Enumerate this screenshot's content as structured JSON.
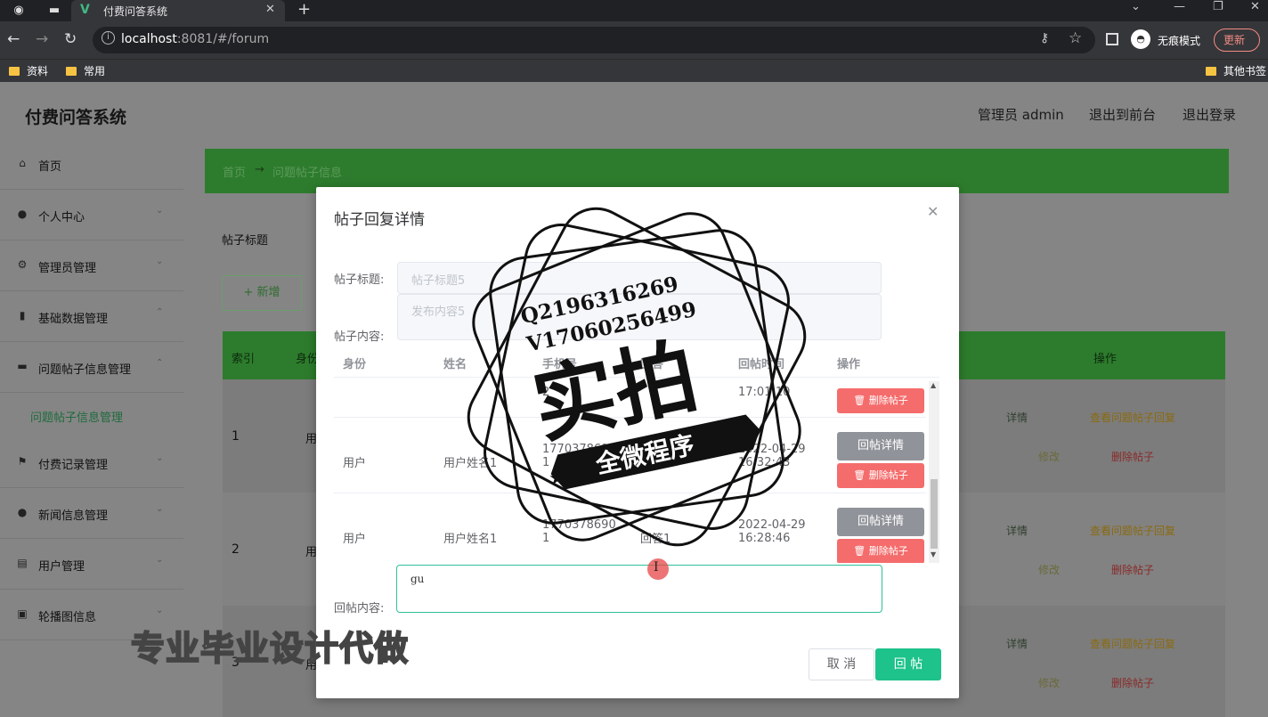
{
  "browser": {
    "tab_title": "付费问答系统",
    "url_host": "localhost",
    "url_rest": ":8081/#/forum",
    "incognito_label": "无痕模式",
    "update_label": "更新",
    "bookmarks": [
      "资料",
      "常用",
      "其他书签"
    ]
  },
  "app": {
    "title": "付费问答系统",
    "header_links": [
      "管理员 admin",
      "退出到前台",
      "退出登录"
    ]
  },
  "sidebar": {
    "items": [
      {
        "label": "首页",
        "icon": "home-icon"
      },
      {
        "label": "个人中心",
        "icon": "user-icon"
      },
      {
        "label": "管理员管理",
        "icon": "gear-icon"
      },
      {
        "label": "基础数据管理",
        "icon": "chart-icon"
      },
      {
        "label": "问题帖子信息管理",
        "icon": "monitor-icon"
      },
      {
        "label": "付费记录管理",
        "icon": "flag-icon"
      },
      {
        "label": "新闻信息管理",
        "icon": "bulb-icon"
      },
      {
        "label": "用户管理",
        "icon": "clipboard-icon"
      },
      {
        "label": "轮播图信息",
        "icon": "image-icon"
      }
    ],
    "sub_item": "问题帖子信息管理"
  },
  "main": {
    "breadcrumb": [
      "首页",
      "→",
      "问题帖子信息"
    ],
    "search_label": "帖子标题",
    "add_label": "+ 新增",
    "table_head": [
      "索引",
      "身份",
      "操作"
    ],
    "rows": [
      {
        "num": "1",
        "user": "用"
      },
      {
        "num": "2",
        "user": "用"
      },
      {
        "num": "3",
        "user": "用"
      }
    ],
    "row_actions": [
      "详情",
      "查看问题帖子回复",
      "修改",
      "删除帖子"
    ]
  },
  "modal": {
    "title": "帖子回复详情",
    "post_title_label": "帖子标题:",
    "post_title_value": "帖子标题5",
    "post_content_label": "帖子内容:",
    "post_content_value": "发布内容5",
    "columns": [
      "身份",
      "姓名",
      "手机号",
      "回答",
      "回帖时间",
      "操作"
    ],
    "partial_row": {
      "phone": "2",
      "time": "17:01:10",
      "delete": "删除帖子"
    },
    "rows": [
      {
        "identity": "用户",
        "name": "用户姓名1",
        "phone": "17703786901",
        "answer": "",
        "time": "2022-04-29 16:32:43",
        "detail": "回帖详情",
        "delete": "删除帖子"
      },
      {
        "identity": "用户",
        "name": "用户姓名1",
        "phone": "17703786901",
        "answer": "回答1",
        "time": "2022-04-29 16:28:46",
        "detail": "回帖详情",
        "delete": "删除帖子"
      }
    ],
    "reply_label": "回帖内容:",
    "reply_value": "gu",
    "cancel_label": "取 消",
    "submit_label": "回 帖"
  },
  "stamp": {
    "q_line": "Q2196316269",
    "v_line": "V17060256499",
    "big_text": "实拍",
    "banner": "全微程序"
  },
  "overlay_text": "专业毕业设计代做"
}
